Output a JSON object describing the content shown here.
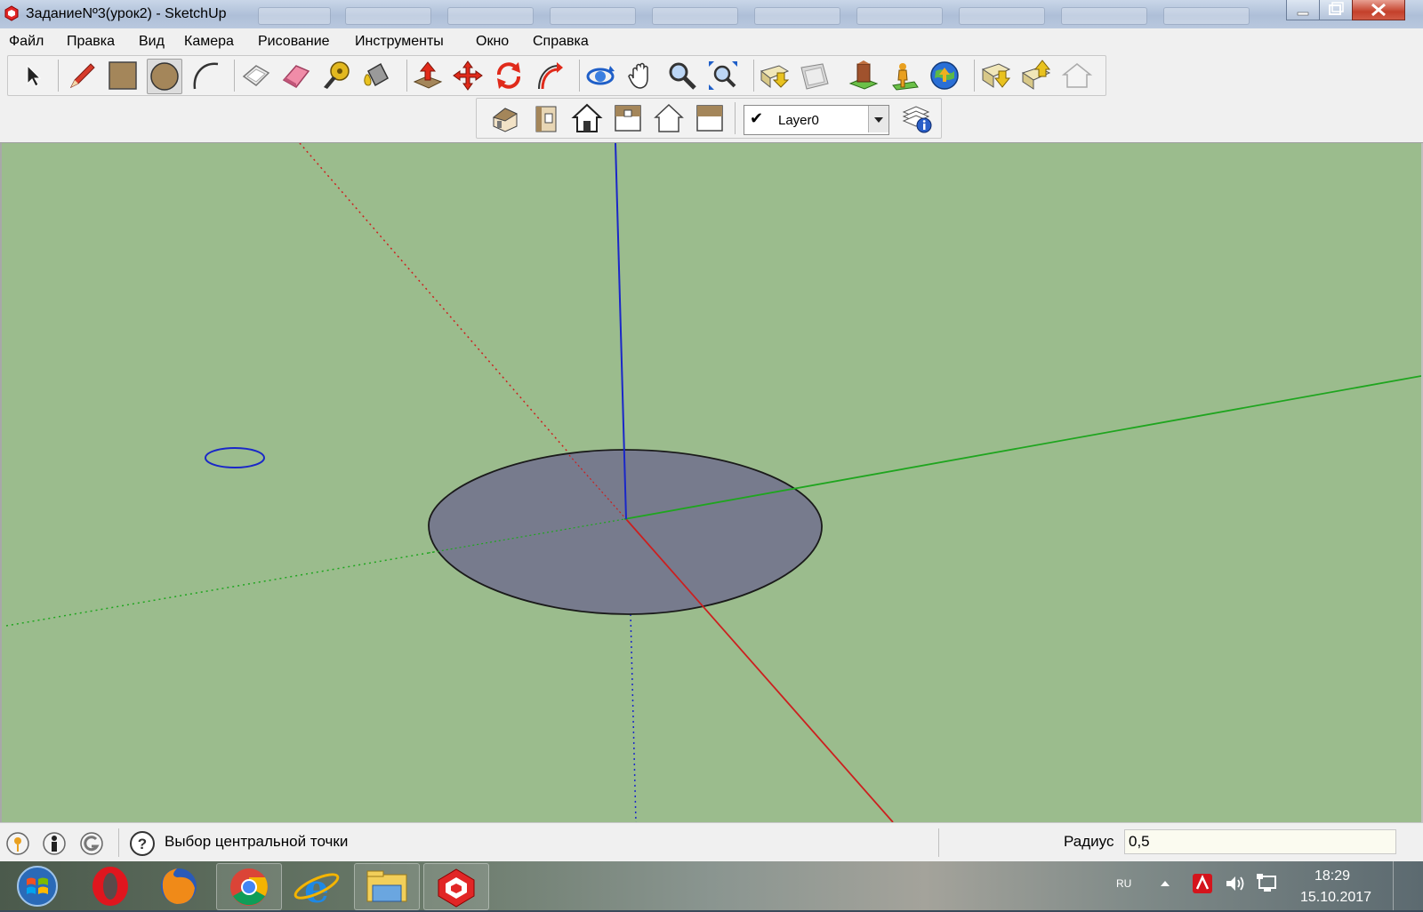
{
  "window": {
    "title": "ЗаданиеNº3(урок2) - SketchUp"
  },
  "menu": [
    "Файл",
    "Правка",
    "Вид",
    "Камера",
    "Рисование",
    "Инструменты",
    "Окно",
    "Справка"
  ],
  "toolbar": {
    "tools": [
      "select-icon",
      "pencil-icon",
      "rectangle-icon",
      "circle-icon",
      "arc-icon",
      "make-component-icon",
      "eraser-icon",
      "tape-measure-icon",
      "paint-bucket-icon",
      "push-pull-icon",
      "move-icon",
      "rotate-icon",
      "follow-me-icon",
      "orbit-icon",
      "pan-icon",
      "zoom-icon",
      "zoom-extents-icon",
      "get-models-icon",
      "share-model-icon",
      "component-warehouse-icon",
      "add-location-icon",
      "google-earth-icon",
      "import-icon",
      "export-icon",
      "preview-icon"
    ],
    "active_tool": "circle-icon",
    "views": [
      "iso-view-icon",
      "front-view-icon",
      "front-house-icon",
      "top-view-icon",
      "back-view-icon",
      "side-view-icon"
    ]
  },
  "layers": {
    "current": "Layer0",
    "checked": true
  },
  "status": {
    "message": "Выбор центральной точки",
    "measurement_label": "Радиус",
    "measurement_value": "0,5"
  },
  "taskbar": {
    "apps": [
      "start-orb-icon",
      "opera-icon",
      "firefox-icon",
      "chrome-icon",
      "ie-icon",
      "explorer-icon",
      "sketchup-icon"
    ],
    "language": "RU",
    "time": "18:29",
    "date": "15.10.2017"
  },
  "colors": {
    "viewport": "#9bbc8d",
    "circle_face": "#777b8d",
    "axis_red": "#cc1f1f",
    "axis_green": "#1fa51f",
    "axis_blue": "#1a27c8"
  }
}
